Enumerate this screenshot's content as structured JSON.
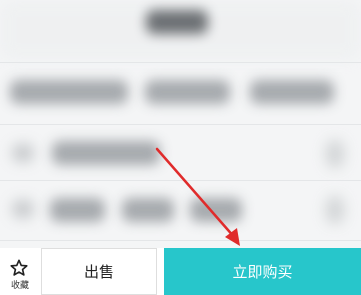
{
  "bottom_bar": {
    "favorite_label": "收藏",
    "sell_label": "出售",
    "buy_label": "立即购买"
  },
  "colors": {
    "buy_button_bg": "#27c6cb",
    "annotation_arrow": "#e02b2b"
  },
  "icons": {
    "favorite": "star-outline-icon"
  }
}
